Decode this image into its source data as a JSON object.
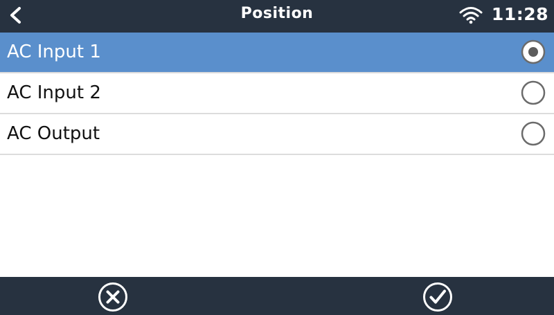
{
  "header": {
    "title": "Position",
    "time": "11:28",
    "back_icon": "chevron-left-icon",
    "wifi_icon": "wifi-icon"
  },
  "options": [
    {
      "label": "AC Input 1",
      "selected": true
    },
    {
      "label": "AC Input 2",
      "selected": false
    },
    {
      "label": "AC Output",
      "selected": false
    }
  ],
  "footer": {
    "cancel_icon": "cancel-circle-icon",
    "confirm_icon": "checkmark-circle-icon"
  },
  "colors": {
    "header_bg": "#273240",
    "selected_row": "#5a8fcc",
    "divider": "#dcdcdc"
  }
}
